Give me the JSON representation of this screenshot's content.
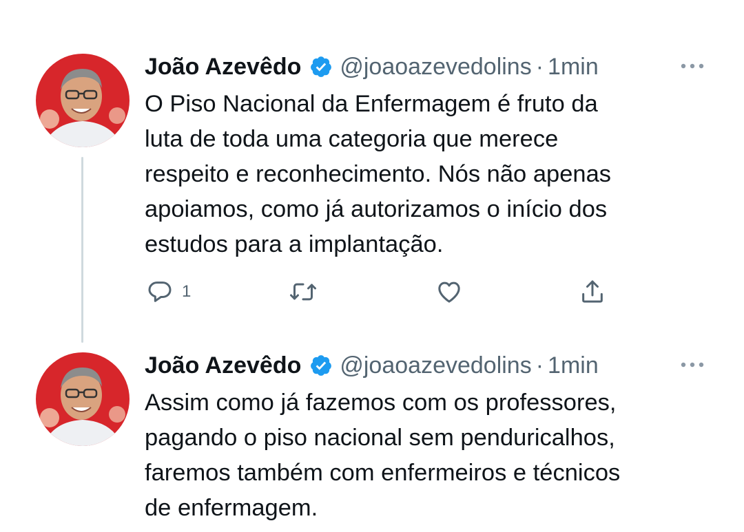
{
  "tweets": [
    {
      "author_name": "João Azevêdo",
      "handle": "@joaoazevedolins",
      "separator": "·",
      "time": "1min",
      "text_lines": [
        "O Piso Nacional da Enfermagem é fruto da",
        "luta de toda uma categoria que merece",
        "respeito e reconhecimento. Nós não apenas",
        "apoiamos, como já autorizamos o início dos",
        "estudos para a implantação."
      ],
      "reply_count": "1",
      "icons": [
        "verified-badge-icon",
        "more-options-icon",
        "reply-icon",
        "retweet-icon",
        "like-icon",
        "share-icon"
      ]
    },
    {
      "author_name": "João Azevêdo",
      "handle": "@joaoazevedolins",
      "separator": "·",
      "time": "1min",
      "text_lines": [
        "Assim como já fazemos com os professores,",
        "pagando o piso nacional sem penduricalhos,",
        "faremos também com enfermeiros e técnicos",
        "de enfermagem."
      ],
      "icons": [
        "verified-badge-icon",
        "more-options-icon"
      ]
    }
  ],
  "colors": {
    "verified": "#1d9bf0",
    "secondary_text": "#536471",
    "thread_line": "#cfd9de",
    "avatar_background": "#d7262b"
  }
}
